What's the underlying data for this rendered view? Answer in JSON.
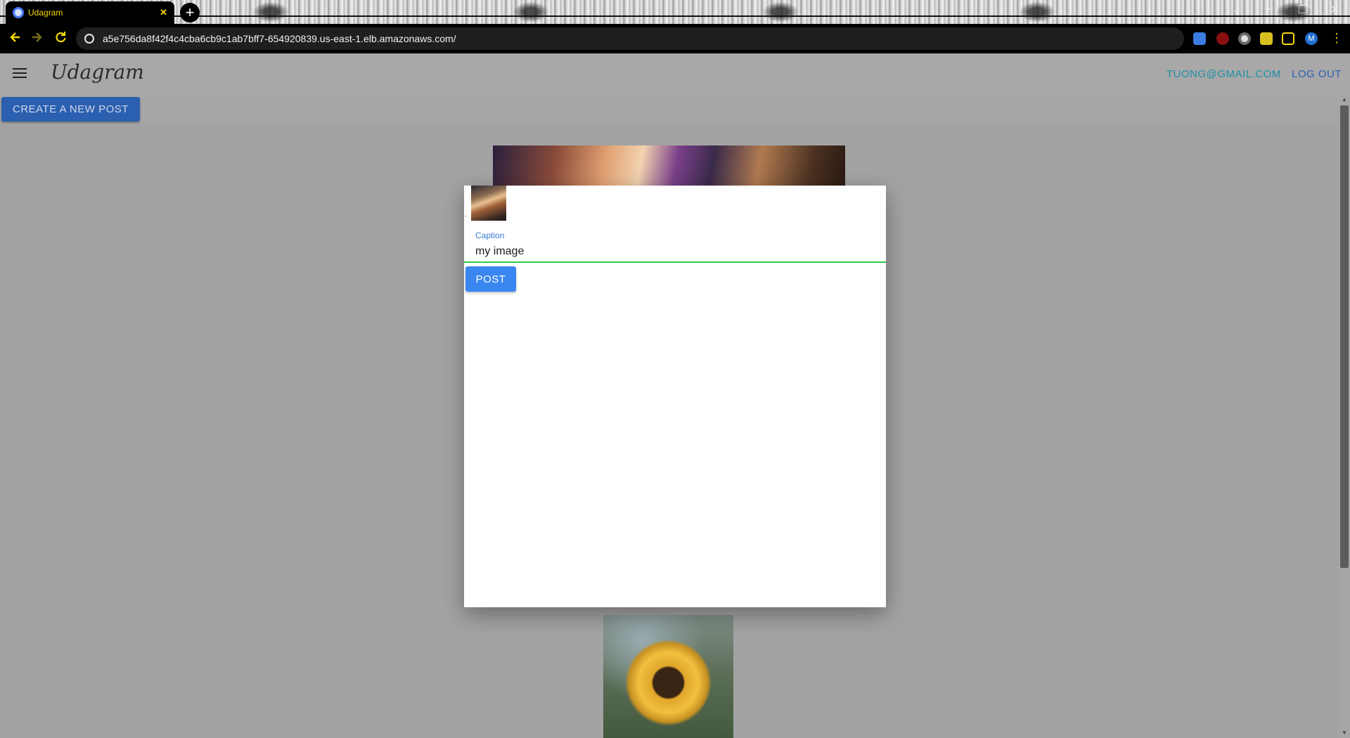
{
  "browser": {
    "tab_title": "Udagram",
    "tab_close": "✕",
    "new_tab": "+",
    "url": "a5e756da8f42f4c4cba6cb9c1ab7bff7-654920839.us-east-1.elb.amazonaws.com/",
    "back_icon": "arrow-left-icon",
    "forward_icon": "arrow-right-icon",
    "reload_icon": "reload-icon",
    "profile_initial": "M",
    "extensions": [
      "translate-icon",
      "ublock-icon",
      "circle-extension-icon",
      "puzzle-icon",
      "sidepanel-icon"
    ],
    "menu_glyph": "⋮",
    "window_controls": [
      "⌄",
      "–",
      "❐",
      "✕"
    ]
  },
  "header": {
    "brand": "Udagram",
    "user_email": "TUONG@GMAIL.COM",
    "logout": "LOG OUT"
  },
  "actions": {
    "create_post": "CREATE A NEW POST"
  },
  "modal": {
    "caption_label": "Caption",
    "caption_value": "my image",
    "post_button": "POST"
  },
  "colors": {
    "accent_blue": "#3a86f0",
    "link_teal": "#1f8fa8",
    "input_underline": "#2ecc4a",
    "url_text": "#f2f2f2",
    "tab_text": "#f5d800"
  }
}
